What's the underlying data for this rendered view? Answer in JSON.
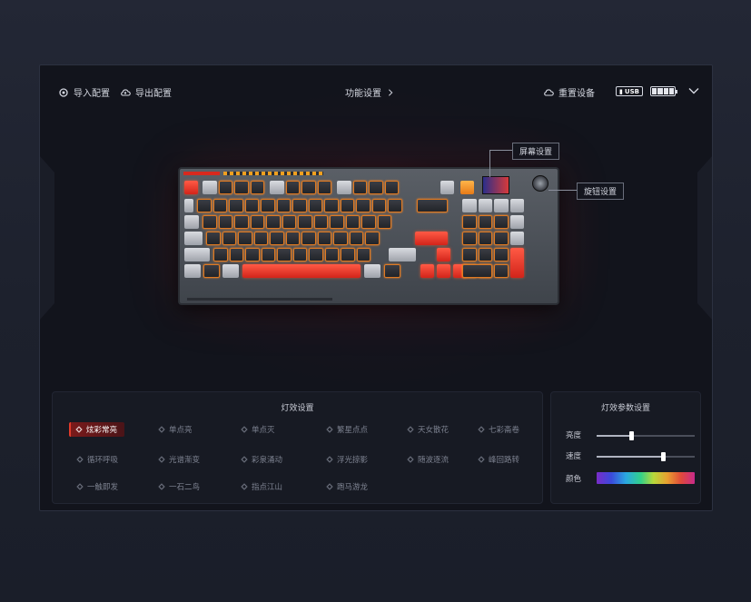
{
  "topbar": {
    "import_label": "导入配置",
    "export_label": "导出配置",
    "center_label": "功能设置",
    "reset_label": "重置设备",
    "usb_label": "USB"
  },
  "keyboard": {
    "callout_screen": "屏幕设置",
    "callout_knob": "旋钮设置"
  },
  "effects": {
    "title": "灯效设置",
    "items": [
      {
        "label": "炫彩常亮",
        "icon": "sparkle-icon",
        "active": true
      },
      {
        "label": "单点亮",
        "icon": "sun-icon"
      },
      {
        "label": "单点灭",
        "icon": "bulb-icon"
      },
      {
        "label": "繁星点点",
        "icon": "star-icon"
      },
      {
        "label": "天女散花",
        "icon": "flower-icon"
      },
      {
        "label": "七彩斋卷",
        "icon": "swirl-icon"
      },
      {
        "label": "循环呼吸",
        "icon": "breath-icon"
      },
      {
        "label": "光谱渐变",
        "icon": "spectrum-icon"
      },
      {
        "label": "彩泉涌动",
        "icon": "fountain-icon"
      },
      {
        "label": "浮光掠影",
        "icon": "glow-icon"
      },
      {
        "label": "随波逐流",
        "icon": "wave-icon"
      },
      {
        "label": "峰回路转",
        "icon": "loop-icon"
      },
      {
        "label": "一触即发",
        "icon": "touch-icon"
      },
      {
        "label": "一石二鸟",
        "icon": "stone-icon"
      },
      {
        "label": "指点江山",
        "icon": "point-icon"
      },
      {
        "label": "跑马游龙",
        "icon": "marquee-icon"
      }
    ]
  },
  "params": {
    "title": "灯效参数设置",
    "brightness_label": "亮度",
    "brightness_value": 0.35,
    "speed_label": "速度",
    "speed_value": 0.68,
    "color_label": "颜色"
  }
}
